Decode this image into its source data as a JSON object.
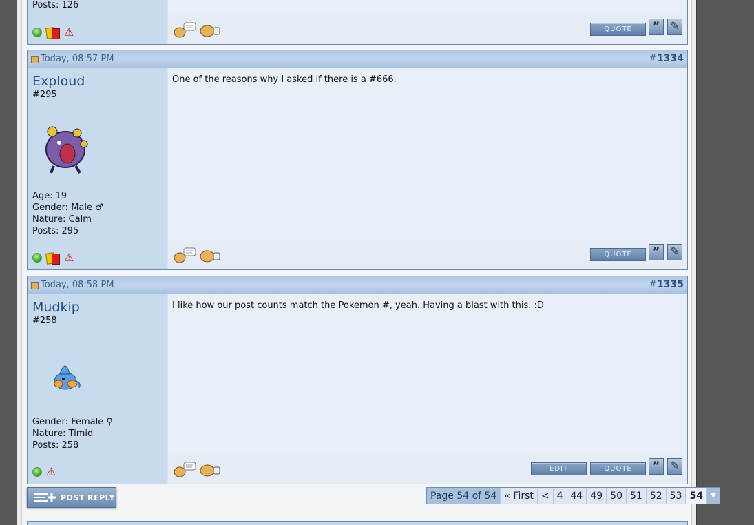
{
  "top_stub": {
    "posts": "Posts: 126"
  },
  "buttons": {
    "quote": "QUOTE",
    "edit": "EDIT",
    "multiquote": "”",
    "post_reply": "POST REPLY"
  },
  "posts": [
    {
      "date": "Today, 08:57 PM",
      "hash": "#",
      "number": "1334",
      "username": "Exploud",
      "dex": "#295",
      "stats": [
        "Age: 19",
        "Gender: Male ♂",
        "Nature: Calm",
        "Posts: 295"
      ],
      "message": "One of the reasons why I asked if there is a #666."
    },
    {
      "date": "Today, 08:58 PM",
      "hash": "#",
      "number": "1335",
      "username": "Mudkip",
      "dex": "#258",
      "stats": [
        "Gender: Female ♀",
        "Nature: Timid",
        "Posts: 258"
      ],
      "message": "I like how our post counts match the Pokemon #, yeah. Having a blast with this. :D"
    }
  ],
  "pagination": {
    "label": "Page 54 of 54",
    "first": "« First",
    "prev": "<",
    "pages": [
      "4",
      "44",
      "49",
      "50",
      "51",
      "52",
      "53",
      "54"
    ],
    "current": "54"
  }
}
